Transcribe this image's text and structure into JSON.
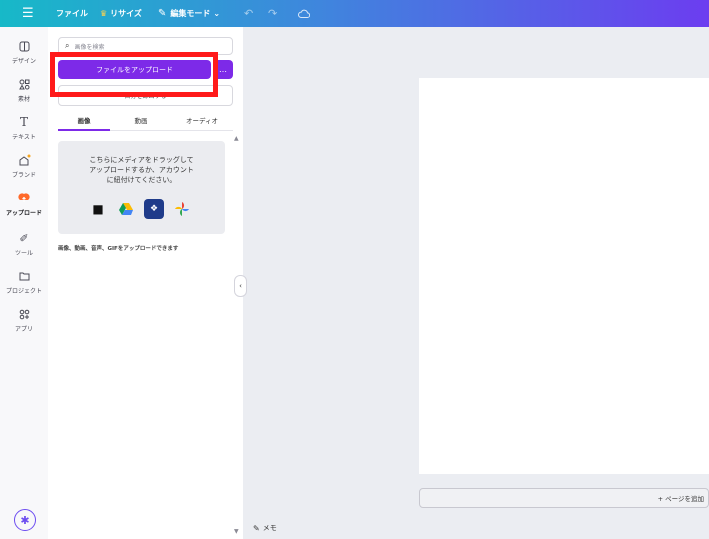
{
  "topbar": {
    "menu_icon": "☰",
    "file_label": "ファイル",
    "resize_label": "リサイズ",
    "resize_icon": "crown-icon",
    "edit_mode_label": "編集モード",
    "undo_icon": "↶",
    "redo_icon": "↷",
    "cloud_icon": "cloud-sync-icon"
  },
  "rail": {
    "items": [
      {
        "label": "デザイン",
        "icon": "design-icon"
      },
      {
        "label": "素材",
        "icon": "elements-icon"
      },
      {
        "label": "テキスト",
        "icon": "text-icon"
      },
      {
        "label": "ブランド",
        "icon": "brand-icon"
      },
      {
        "label": "アップロード",
        "icon": "upload-icon"
      },
      {
        "label": "ツール",
        "icon": "tools-icon"
      },
      {
        "label": "プロジェクト",
        "icon": "folder-icon"
      },
      {
        "label": "アプリ",
        "icon": "apps-icon"
      }
    ],
    "active_index": 4
  },
  "panel": {
    "search_placeholder": "画像を検索",
    "upload_button": "ファイルをアップロード",
    "more_button": "…",
    "record_button": "自分を録画する",
    "tabs": [
      "画像",
      "動画",
      "オーディオ"
    ],
    "active_tab": 0,
    "drop_text": "こちらにメディアをドラッグして\nアップロードするか、アカウント\nに紐付けてください。",
    "sources": [
      "CapCut",
      "Google Drive",
      "Dropbox",
      "Google Photos"
    ],
    "formats_note": "画像、動画、音声、GIFをアップロードできます"
  },
  "canvas": {
    "add_page_label": "+ ページを追加",
    "memo_label": "メモ"
  },
  "colors": {
    "accent": "#7d2ae8",
    "highlight": "#ff1a1a",
    "topbar_start": "#17b9c8",
    "topbar_end": "#6c3df0"
  }
}
